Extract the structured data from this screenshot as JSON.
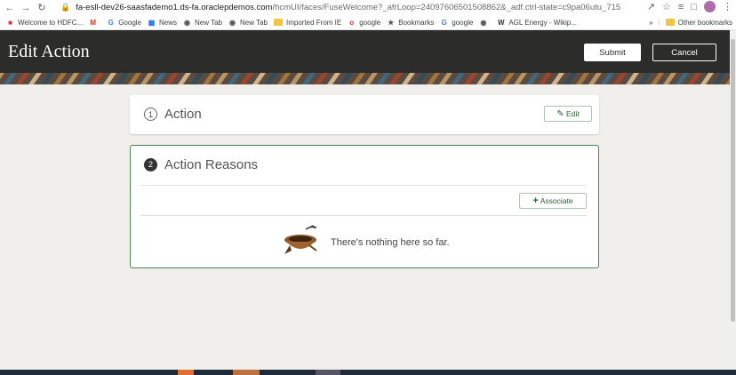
{
  "browser": {
    "url_host": "fa-esll-dev26-saasfademo1.ds-fa.oraclepdemos.com",
    "url_path": "/hcmUI/faces/FuseWelcome?_afrLoop=24097606501508862&_adf.ctrl-state=c9pa06utu_715",
    "bookmarks": [
      {
        "label": "Welcome to HDFC...",
        "icon": "hdfc-icon",
        "color": "#d33"
      },
      {
        "label": "",
        "icon": "gmail-icon",
        "color": "#d93025"
      },
      {
        "label": "Google",
        "icon": "google-icon",
        "color": "#4285f4"
      },
      {
        "label": "News",
        "icon": "news-icon",
        "color": "#1a73e8"
      },
      {
        "label": "New Tab",
        "icon": "globe-icon",
        "color": "#555"
      },
      {
        "label": "New Tab",
        "icon": "globe-icon",
        "color": "#555"
      },
      {
        "label": "Imported From IE",
        "icon": "folder-icon",
        "color": "#f4c542"
      },
      {
        "label": "google",
        "icon": "opera-icon",
        "color": "#d33"
      },
      {
        "label": "Bookmarks",
        "icon": "star-icon",
        "color": "#555"
      },
      {
        "label": "google",
        "icon": "google-icon",
        "color": "#4285f4"
      },
      {
        "label": "",
        "icon": "globe-icon",
        "color": "#555"
      },
      {
        "label": "AGL Energy - Wikip...",
        "icon": "wikipedia-icon",
        "color": "#333"
      }
    ],
    "more_bookmarks": "»",
    "other_bookmarks": "Other bookmarks"
  },
  "header": {
    "title": "Edit Action",
    "submit_label": "Submit",
    "cancel_label": "Cancel"
  },
  "sections": {
    "action": {
      "number": "1",
      "title": "Action",
      "edit_label": "Edit"
    },
    "reasons": {
      "number": "2",
      "title": "Action Reasons",
      "associate_label": "Associate",
      "empty_text": "There's nothing here so far."
    }
  },
  "colors": {
    "header_bg": "#2c2c2b",
    "accent_green": "#4b8254",
    "page_bg": "#f0efec"
  }
}
